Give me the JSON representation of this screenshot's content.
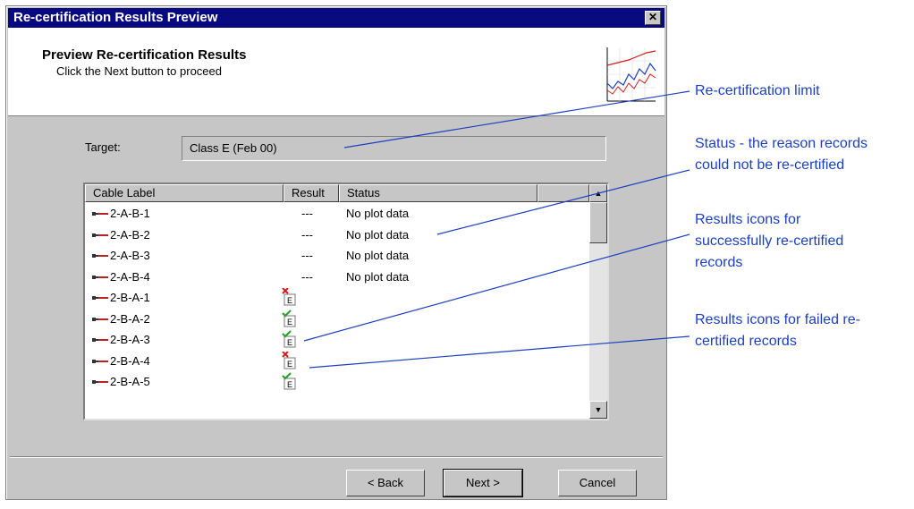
{
  "dialog": {
    "title": "Re-certification Results Preview",
    "close_glyph": "✕",
    "header_title": "Preview Re-certification Results",
    "header_subtitle": "Click the Next button to proceed",
    "header_icon": "chart-thumbnail-icon"
  },
  "target": {
    "label": "Target:",
    "value": "Class E (Feb 00)"
  },
  "list": {
    "columns": [
      "Cable Label",
      "Result",
      "Status"
    ],
    "rows": [
      {
        "label": "2-A-B-1",
        "result": "---",
        "status": "No plot data",
        "result_icon": ""
      },
      {
        "label": "2-A-B-2",
        "result": "---",
        "status": "No plot data",
        "result_icon": ""
      },
      {
        "label": "2-A-B-3",
        "result": "---",
        "status": "No plot data",
        "result_icon": ""
      },
      {
        "label": "2-A-B-4",
        "result": "---",
        "status": "No plot data",
        "result_icon": ""
      },
      {
        "label": "2-B-A-1",
        "result": "",
        "status": "",
        "result_icon": "fail-icon"
      },
      {
        "label": "2-B-A-2",
        "result": "",
        "status": "",
        "result_icon": "pass-icon"
      },
      {
        "label": "2-B-A-3",
        "result": "",
        "status": "",
        "result_icon": "pass-icon"
      },
      {
        "label": "2-B-A-4",
        "result": "",
        "status": "",
        "result_icon": "fail-icon"
      },
      {
        "label": "2-B-A-5",
        "result": "",
        "status": "",
        "result_icon": "pass-icon"
      }
    ],
    "scroll_up_glyph": "▲",
    "scroll_down_glyph": "▼"
  },
  "buttons": {
    "back": "< Back",
    "next": "Next >",
    "cancel": "Cancel"
  },
  "callouts": {
    "limit": "Re-certification limit",
    "status_line1": "Status -  the reason records",
    "status_line2": "could not be re-certified",
    "success_line1": "Results icons for",
    "success_line2": "successfully re-certified",
    "success_line3": "records",
    "failed_line1": "Results icons for failed re-",
    "failed_line2": "certified records"
  },
  "colors": {
    "callout_text": "#1c3fc0",
    "titlebar": "#0a0a80",
    "pass": "#2e9e2e",
    "fail": "#d21c1c"
  }
}
